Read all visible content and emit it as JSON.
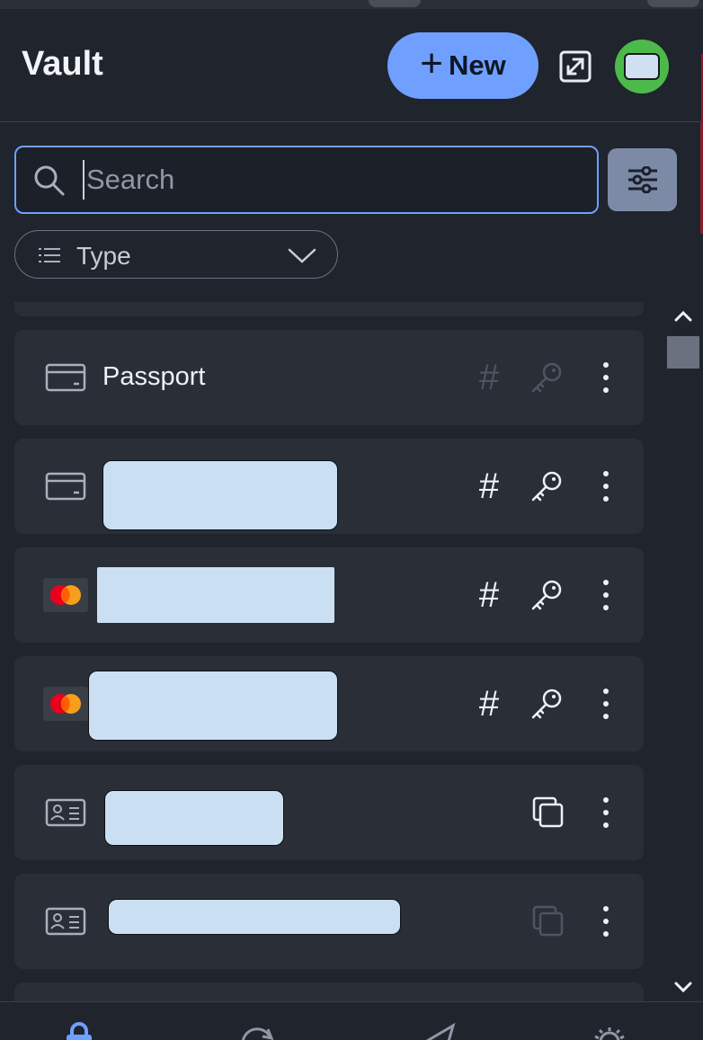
{
  "header": {
    "title": "Vault",
    "new_label": "New"
  },
  "search": {
    "placeholder": "Search",
    "value": ""
  },
  "filter": {
    "type_label": "Type"
  },
  "items": [
    {
      "name": "Passport",
      "icon": "card-icon",
      "actions": [
        "hash-icon-dim",
        "key-icon-dim",
        "more-icon"
      ]
    },
    {
      "name": "",
      "icon": "card-icon",
      "actions": [
        "hash-icon",
        "key-icon",
        "more-icon"
      ],
      "redacted": true
    },
    {
      "name": "",
      "icon": "mastercard-icon",
      "actions": [
        "hash-icon",
        "key-icon",
        "more-icon"
      ],
      "redacted": true
    },
    {
      "name": "",
      "icon": "mastercard-icon",
      "actions": [
        "hash-icon",
        "key-icon",
        "more-icon"
      ],
      "redacted": true
    },
    {
      "name": "",
      "icon": "identity-icon",
      "actions": [
        "copy-icon",
        "more-icon"
      ],
      "redacted": true
    },
    {
      "name": "",
      "icon": "identity-icon",
      "actions": [
        "copy-icon-dim",
        "more-icon"
      ],
      "redacted": true
    }
  ],
  "hash_glyph": "#",
  "colors": {
    "accent": "#6fa0ff",
    "background": "#20242c",
    "card": "#2a2e37",
    "avatar": "#4cba4a",
    "filter_button": "#7d8aa6",
    "mastercard_red": "#eb001b",
    "mastercard_orange": "#f79e1b"
  },
  "bottom_nav": [
    "vault-icon",
    "generator-icon",
    "send-icon",
    "settings-icon"
  ]
}
